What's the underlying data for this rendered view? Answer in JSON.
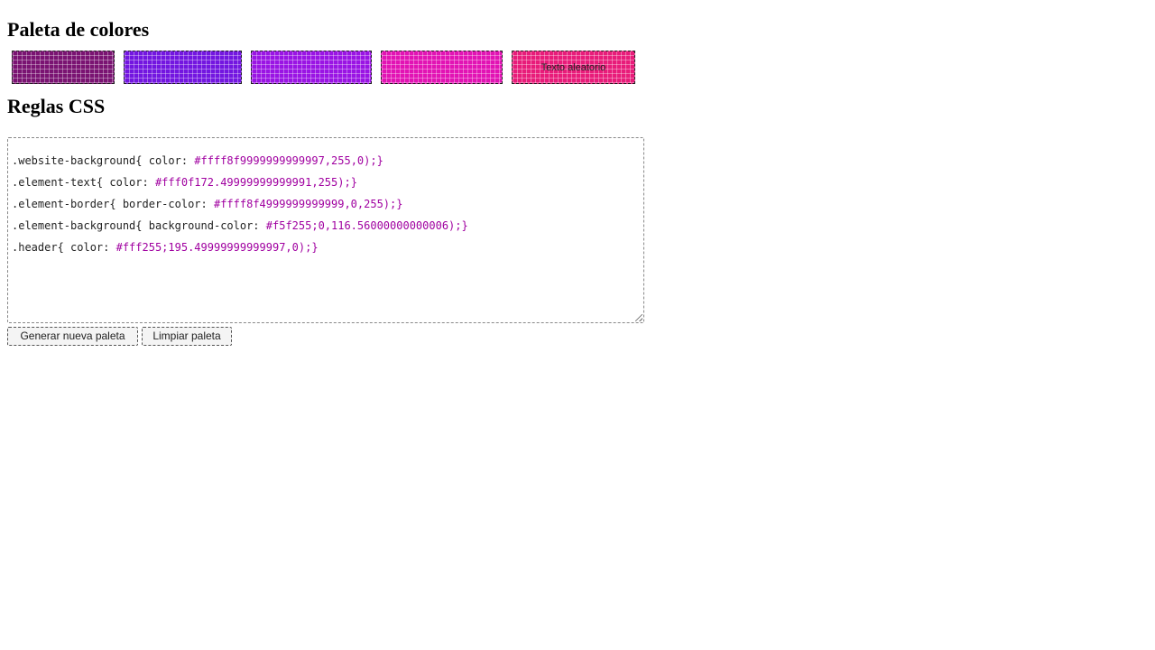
{
  "headings": {
    "palette": "Paleta de colores",
    "rules": "Reglas CSS"
  },
  "palette": {
    "swatches": [
      {
        "name": "swatch-1",
        "color": "#7a1372",
        "text": ""
      },
      {
        "name": "swatch-2",
        "color": "#7316e0",
        "text": ""
      },
      {
        "name": "swatch-3",
        "color": "#9a14e4",
        "text": ""
      },
      {
        "name": "swatch-4",
        "color": "#e213b4",
        "text": ""
      },
      {
        "name": "swatch-5",
        "color": "#e81c7a",
        "text": "Texto aleatorio"
      }
    ]
  },
  "css_rules": [
    {
      "selector": ".website-background{ color: ",
      "value": "#ffff8f9999999999997,255,0);}"
    },
    {
      "selector": ".element-text{ color: ",
      "value": "#fff0f172.49999999999991,255);}"
    },
    {
      "selector": ".element-border{ border-color: ",
      "value": "#ffff8f4999999999999,0,255);}"
    },
    {
      "selector": ".element-background{ background-color: ",
      "value": "#f5f255;0,116.56000000000006);}"
    },
    {
      "selector": ".header{ color: ",
      "value": "#fff255;195.49999999999997,0);}"
    }
  ],
  "buttons": {
    "generate": "Generar nueva paleta",
    "clear": "Limpiar paleta"
  }
}
